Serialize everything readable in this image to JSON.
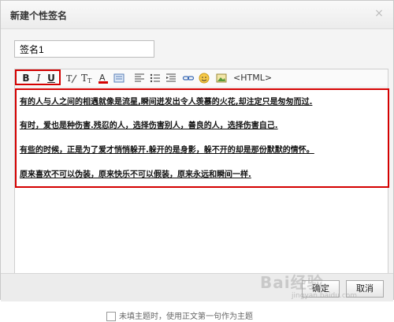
{
  "dialog": {
    "title": "新建个性签名",
    "close_glyph": "×"
  },
  "name_input": {
    "value": "签名1"
  },
  "toolbar": {
    "bold_label": "B",
    "italic_label": "I",
    "underline_label": "U",
    "html_label": "<HTML>",
    "icons": [
      "format-clear-icon",
      "font-size-icon",
      "font-color-icon",
      "highlight-icon",
      "align-left-icon",
      "list-icon",
      "indent-icon",
      "link-icon",
      "emoji-icon",
      "image-icon"
    ]
  },
  "content": {
    "lines": [
      "有的人与人之间的相遇就像是流星,瞬间迸发出令人羡慕的火花,却注定只是匆匆而过.",
      "有时，爱也是种伤害.残忍的人，选择伤害别人，善良的人，选择伤害自己.",
      "有些的时候，正是为了爱才悄悄躲开.躲开的是身影，躲不开的却是那份默默的情怀。",
      "原来喜欢不可以伪装，原来快乐不可以假装，原来永远和瞬间一样."
    ]
  },
  "footer": {
    "ok_label": "确定",
    "cancel_label": "取消"
  },
  "watermark": {
    "main": "Bai经验",
    "sub": "jingyan.baidu.com"
  },
  "option": {
    "label": "未填主题时，使用正文第一句作为主题"
  },
  "colors": {
    "highlight_border": "#d40000"
  }
}
